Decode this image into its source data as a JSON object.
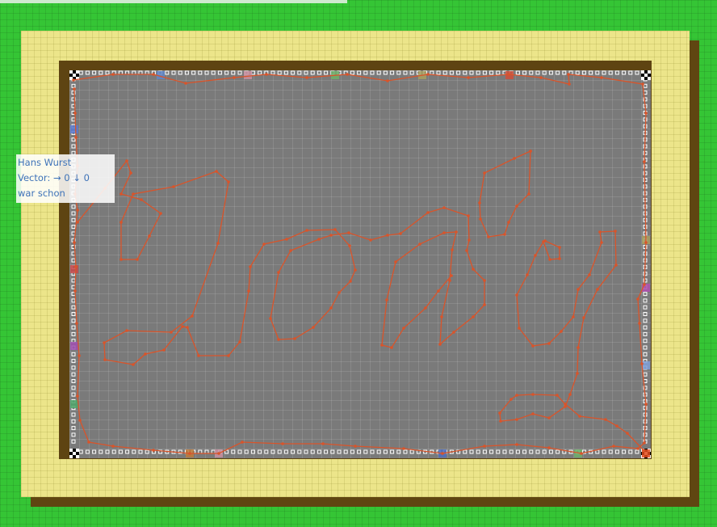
{
  "player": {
    "name": "Hans Wurst",
    "vector_label": "Vector:",
    "vector_x_arrow": "→",
    "vector_x": "0",
    "vector_y_arrow": "↓",
    "vector_y": "0",
    "status": "war schon"
  },
  "colors": {
    "grass": "#35c535",
    "sand": "#ece58a",
    "wall": "#5e4412",
    "track": "#7a7a7a",
    "path": "#d9542a"
  },
  "icons": [
    "checkered-corner-flag",
    "player-car-marker",
    "route-point"
  ]
}
